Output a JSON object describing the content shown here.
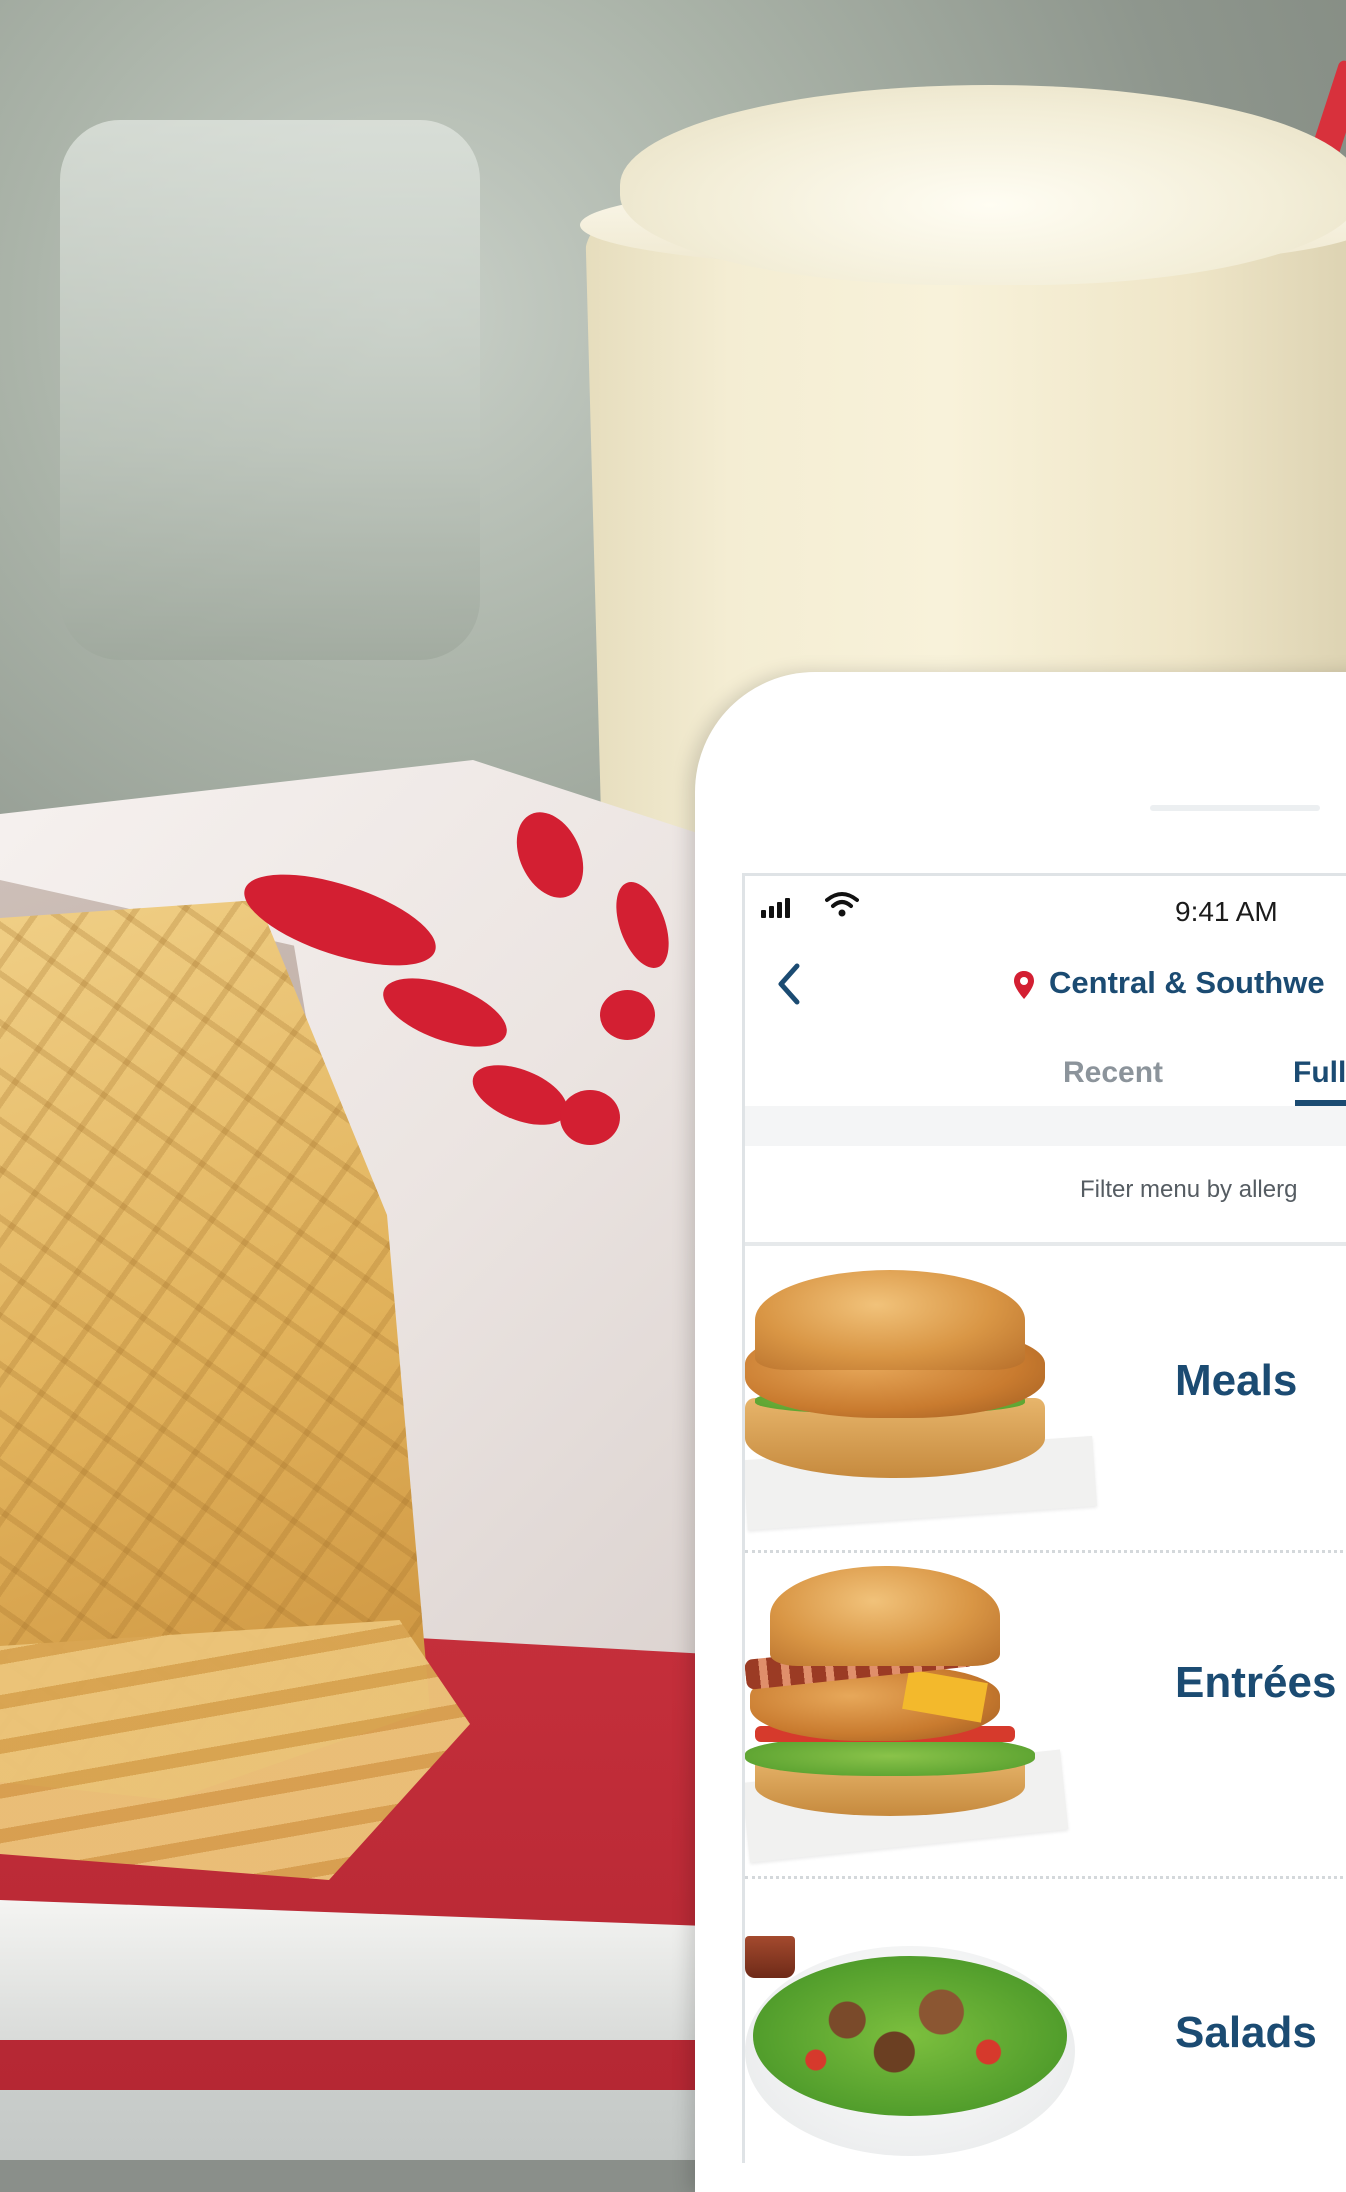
{
  "status_bar": {
    "time": "9:41 AM"
  },
  "nav": {
    "location": "Central & Southwe"
  },
  "tabs": [
    {
      "label": "Recent",
      "selected": false
    },
    {
      "label": "Full",
      "selected": true
    }
  ],
  "filter": {
    "label": "Filter menu by allerg"
  },
  "menu": {
    "items": [
      {
        "label": "Meals"
      },
      {
        "label": "Entrées"
      },
      {
        "label": "Salads"
      }
    ]
  },
  "colors": {
    "brand_navy": "#1b4b72",
    "brand_red": "#d31f32"
  }
}
